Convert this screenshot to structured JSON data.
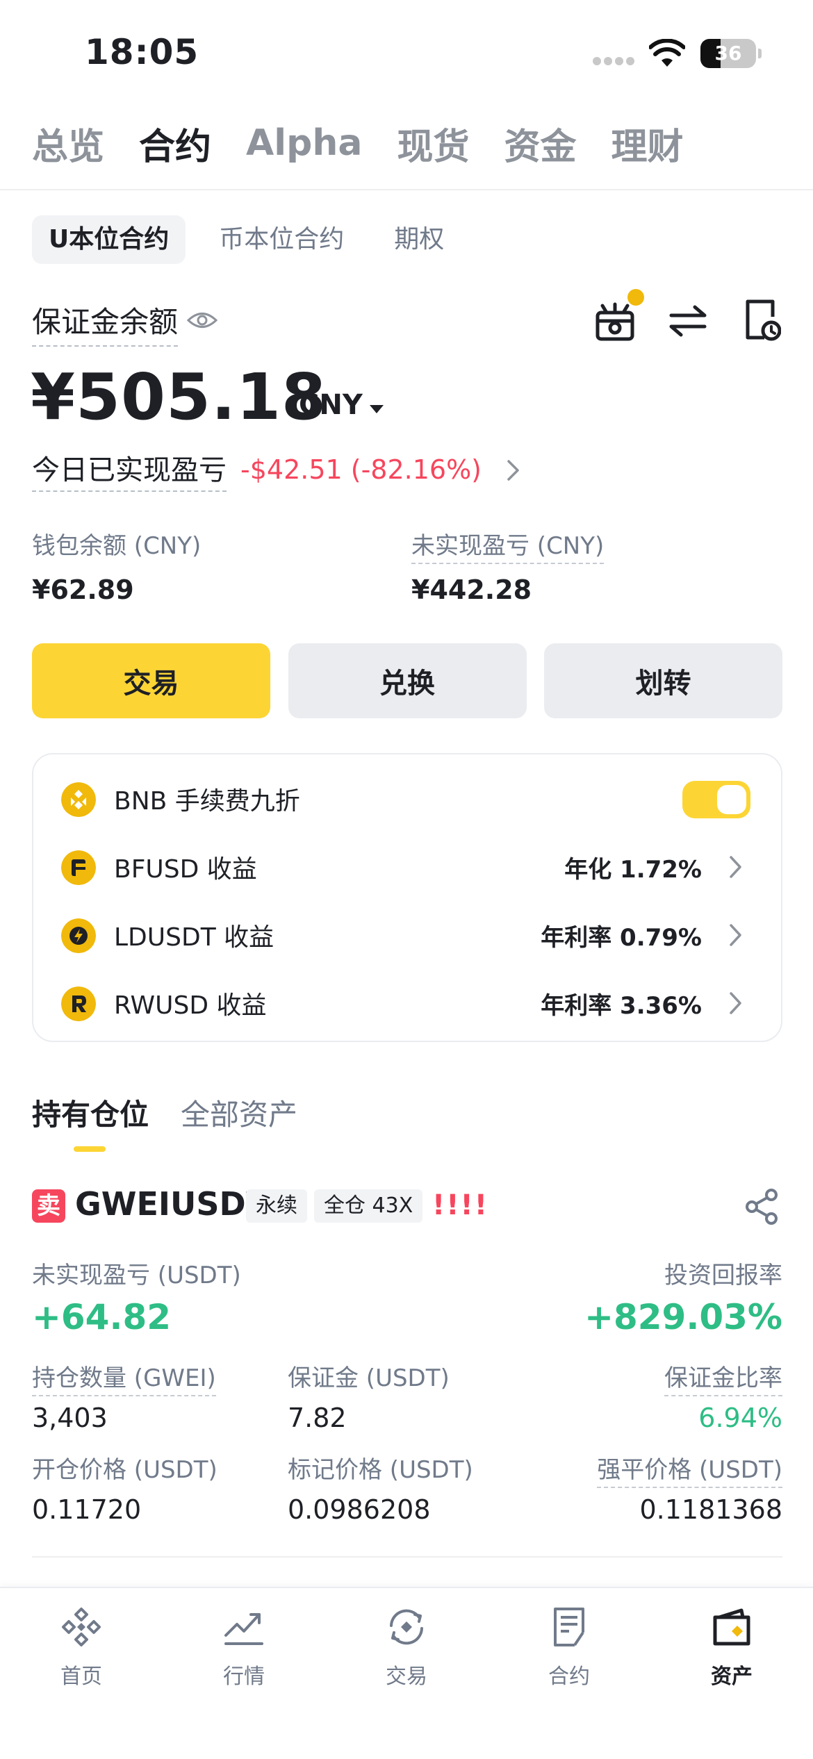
{
  "status_bar": {
    "time": "18:05",
    "battery": "36",
    "battery_level_percent": 36
  },
  "top_tabs": [
    {
      "label": "总览",
      "active": false
    },
    {
      "label": "合约",
      "active": true
    },
    {
      "label": "Alpha",
      "active": false
    },
    {
      "label": "现货",
      "active": false
    },
    {
      "label": "资金",
      "active": false
    },
    {
      "label": "理财",
      "active": false
    }
  ],
  "sub_tabs": [
    {
      "label": "U本位合约",
      "active": true
    },
    {
      "label": "币本位合约",
      "active": false
    },
    {
      "label": "期权",
      "active": false
    }
  ],
  "balance": {
    "label": "保证金余额",
    "value": "¥505.18",
    "currency": "CNY",
    "pnl_label": "今日已实现盈亏",
    "pnl_value": "-$42.51 (-82.16%)"
  },
  "stats": {
    "wallet_label": "钱包余额 (CNY)",
    "wallet_value": "¥62.89",
    "unrealized_label": "未实现盈亏 (CNY)",
    "unrealized_value": "¥442.28"
  },
  "actions": {
    "trade": "交易",
    "convert": "兑换",
    "transfer": "划转"
  },
  "earn": [
    {
      "name": "BNB 手续费九折",
      "rate": "",
      "toggle_on": true
    },
    {
      "name": "BFUSD 收益",
      "rate": "年化 1.72%"
    },
    {
      "name": "LDUSDT 收益",
      "rate": "年利率 0.79%"
    },
    {
      "name": "RWUSD 收益",
      "rate": "年利率 3.36%"
    }
  ],
  "position_tabs": [
    {
      "label": "持有仓位",
      "active": true
    },
    {
      "label": "全部资产",
      "active": false
    }
  ],
  "position": {
    "side": "卖",
    "symbol": "GWEIUSDT",
    "type": "永续",
    "margin_mode": "全仓 43X",
    "risk": "!!!!",
    "unrealized_label": "未实现盈亏 (USDT)",
    "unrealized_value": "+64.82",
    "roi_label": "投资回报率",
    "roi_value": "+829.03%",
    "size_label": "持仓数量 (GWEI)",
    "size_value": "3,403",
    "margin_label": "保证金 (USDT)",
    "margin_value": "7.82",
    "margin_ratio_label": "保证金比率",
    "margin_ratio_value": "6.94%",
    "entry_label": "开仓价格 (USDT)",
    "entry_value": "0.11720",
    "mark_label": "标记价格 (USDT)",
    "mark_value": "0.0986208",
    "liq_label": "强平价格 (USDT)",
    "liq_value": "0.1181368"
  },
  "bottom_nav": [
    {
      "label": "首页",
      "icon": "home-icon",
      "active": false
    },
    {
      "label": "行情",
      "icon": "markets-icon",
      "active": false
    },
    {
      "label": "交易",
      "icon": "trade-icon",
      "active": false
    },
    {
      "label": "合约",
      "icon": "futures-icon",
      "active": false
    },
    {
      "label": "资产",
      "icon": "wallet-icon",
      "active": true
    }
  ],
  "colors": {
    "brand_yellow": "#FCD535",
    "coin_gold": "#F0B90B",
    "red": "#F6465D",
    "green": "#2EBD85",
    "text_primary": "#1E2026",
    "text_secondary": "#707A8A"
  }
}
